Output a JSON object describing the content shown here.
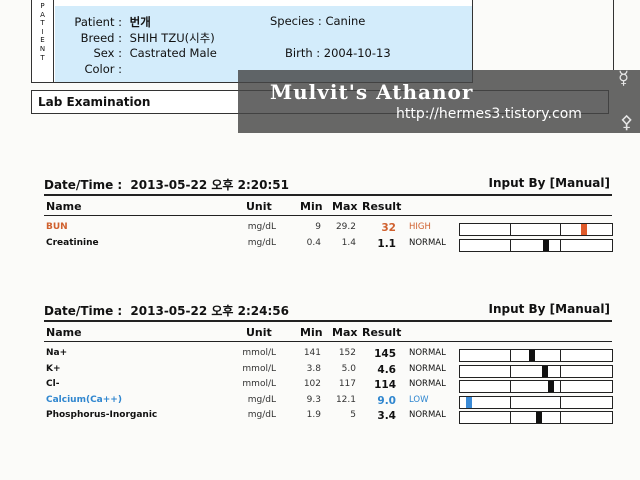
{
  "patient": {
    "side_label": [
      "P",
      "A",
      "T",
      "I",
      "E",
      "N",
      "T"
    ],
    "patient_label": "Patient :",
    "patient_value": "번개",
    "breed_label": "Breed :",
    "breed_value": "SHIH TZU(시추)",
    "sex_label": "Sex :",
    "sex_value": "Castrated Male",
    "color_label": "Color :",
    "color_value": "",
    "species_label": "Species :",
    "species_value": "Canine",
    "birth_label": "Birth :",
    "birth_value": "2004-10-13"
  },
  "lab_title": "Lab Examination",
  "watermark": {
    "title": "Mulvit's Athanor",
    "url": "http://hermes3.tistory.com"
  },
  "headers": {
    "name": "Name",
    "unit": "Unit",
    "min": "Min",
    "max": "Max",
    "result": "Result"
  },
  "panels": [
    {
      "datetime_label": "Date/Time :",
      "datetime_value": "2013-05-22  오후 2:20:51",
      "input_by": "Input By [Manual]",
      "rows": [
        {
          "name": "BUN",
          "unit": "mg/dL",
          "min": "9",
          "max": "29.2",
          "result": "32",
          "flag": "HIGH",
          "marker": 0.83,
          "status": "high"
        },
        {
          "name": "Creatinine",
          "unit": "mg/dL",
          "min": "0.4",
          "max": "1.4",
          "result": "1.1",
          "flag": "NORMAL",
          "marker": 0.57,
          "status": "normal"
        }
      ]
    },
    {
      "datetime_label": "Date/Time :",
      "datetime_value": "2013-05-22  오후 2:24:56",
      "input_by": "Input By [Manual]",
      "rows": [
        {
          "name": "Na+",
          "unit": "mmol/L",
          "min": "141",
          "max": "152",
          "result": "145",
          "flag": "NORMAL",
          "marker": 0.47,
          "status": "normal"
        },
        {
          "name": "K+",
          "unit": "mmol/L",
          "min": "3.8",
          "max": "5.0",
          "result": "4.6",
          "flag": "NORMAL",
          "marker": 0.56,
          "status": "normal"
        },
        {
          "name": "Cl-",
          "unit": "mmol/L",
          "min": "102",
          "max": "117",
          "result": "114",
          "flag": "NORMAL",
          "marker": 0.6,
          "status": "normal"
        },
        {
          "name": "Calcium(Ca++)",
          "unit": "mg/dL",
          "min": "9.3",
          "max": "12.1",
          "result": "9.0",
          "flag": "LOW",
          "marker": 0.04,
          "status": "low"
        },
        {
          "name": "Phosphorus-Inorganic",
          "unit": "mg/dL",
          "min": "1.9",
          "max": "5",
          "result": "3.4",
          "flag": "NORMAL",
          "marker": 0.52,
          "status": "normal"
        }
      ]
    }
  ],
  "colors": {
    "high": "#d0612f",
    "low": "#2f86cf",
    "normal": "#111111",
    "high_marker": "#e05a2a",
    "low_marker": "#3a8ad6",
    "normal_marker": "#111111",
    "patient_fill": "#d3ecfb"
  },
  "icons": [
    "mercury-symbol",
    "sulfur-symbol"
  ]
}
